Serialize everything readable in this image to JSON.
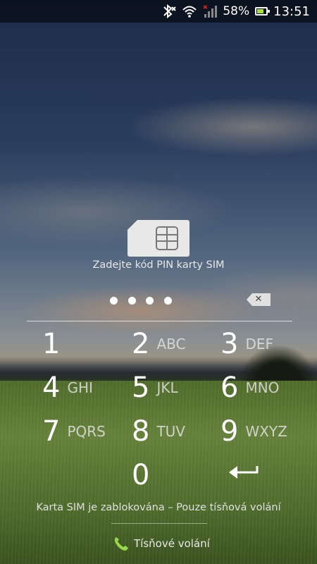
{
  "status_bar": {
    "battery_percent": "58%",
    "time": "13:51",
    "icons": [
      "bluetooth-icon",
      "wifi-icon",
      "signal-icon",
      "battery-icon"
    ]
  },
  "sim_prompt": "Zadejte kód PIN karty SIM",
  "pin_dots": 4,
  "keypad": [
    {
      "number": "1",
      "letters": ""
    },
    {
      "number": "2",
      "letters": "ABC"
    },
    {
      "number": "3",
      "letters": "DEF"
    },
    {
      "number": "4",
      "letters": "GHI"
    },
    {
      "number": "5",
      "letters": "JKL"
    },
    {
      "number": "6",
      "letters": "MNO"
    },
    {
      "number": "7",
      "letters": "PQRS"
    },
    {
      "number": "8",
      "letters": "TUV"
    },
    {
      "number": "9",
      "letters": "WXYZ"
    },
    {
      "number": "0",
      "letters": ""
    }
  ],
  "sim_locked_message": "Karta SIM je zablokována – Pouze tísňová volání",
  "emergency_label": "Tísňové volání",
  "colors": {
    "battery_fill": "#a6e22e",
    "phone_icon": "#9ad84a",
    "signal_error": "#e02020"
  }
}
